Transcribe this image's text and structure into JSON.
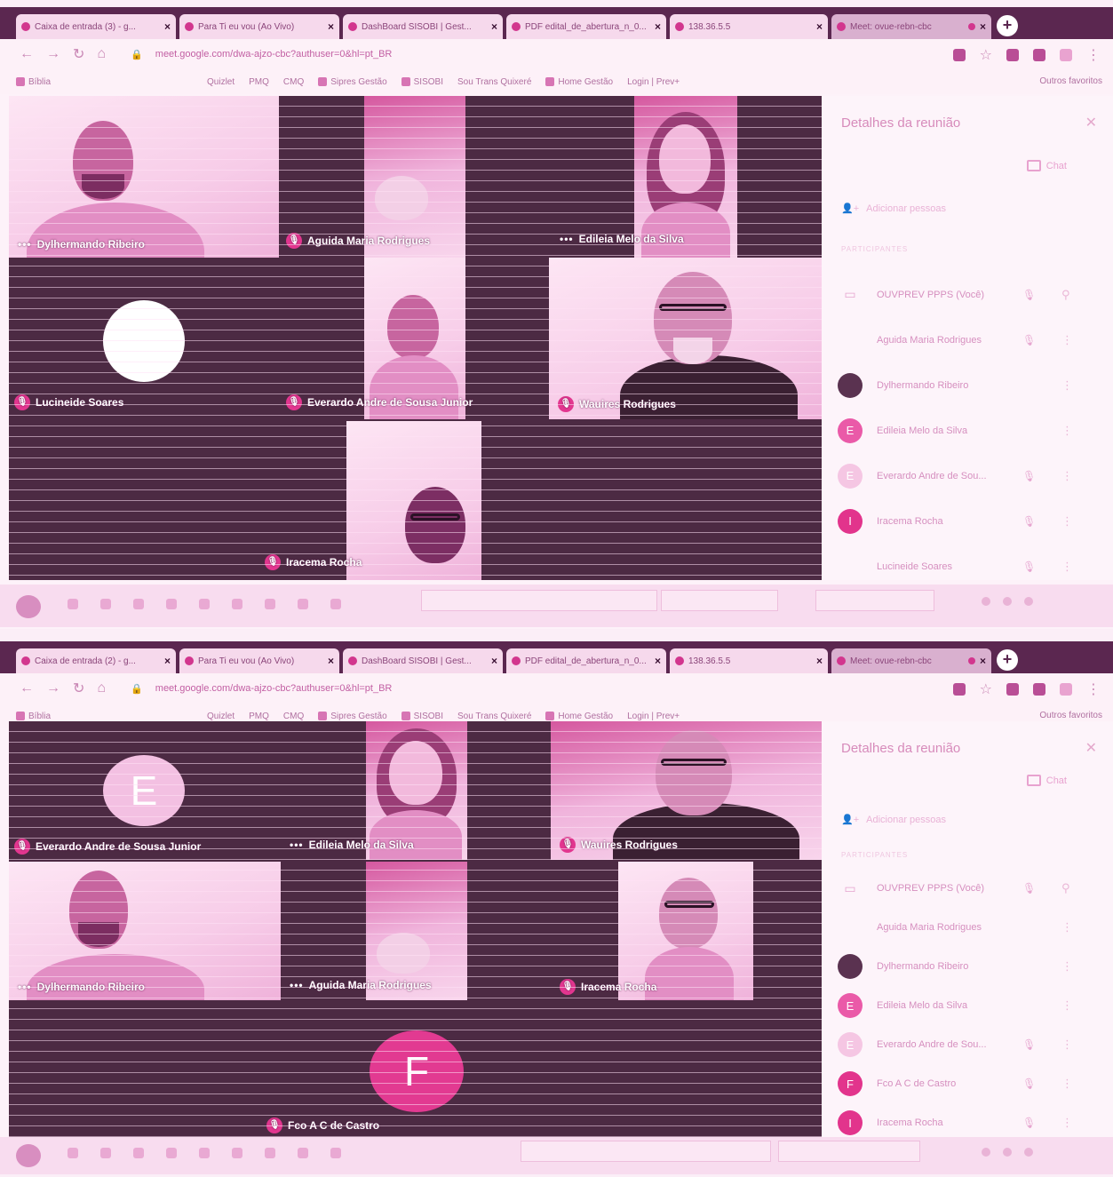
{
  "screens": [
    {
      "tabs": [
        {
          "title": "Caixa de entrada (3) - g...",
          "close": "×"
        },
        {
          "title": "Para Ti eu vou (Ao Vivo)",
          "close": "×"
        },
        {
          "title": "DashBoard SISOBI | Gest...",
          "close": "×"
        },
        {
          "title": "PDF edital_de_abertura_n_0...",
          "close": "×"
        },
        {
          "title": "138.36.5.5",
          "close": "×"
        },
        {
          "title": "Meet: ovue-rebn-cbc",
          "close": "×"
        }
      ],
      "new_tab": "+",
      "url": "meet.google.com/dwa-ajzo-cbc?authuser=0&hl=pt_BR",
      "bookmarks": [
        "Bíblia",
        "Quizlet",
        "PMQ",
        "CMQ",
        "Sipres Gestão",
        "SISOBI",
        "Sou Trans Quixeré",
        "Home Gestão",
        "Login | Prev+"
      ],
      "other_bookmarks": "Outros favoritos",
      "tiles": {
        "dylhermando": "Dylhermando Ribeiro",
        "aguida": "Aguida Maria Rodrigues",
        "edileia": "Edileia Melo da Silva",
        "lucineide": "Lucineide Soares",
        "everardo": "Everardo Andre de Sousa Junior",
        "wauires": "Wauires Rodrigues",
        "iracema": "Iracema Rocha"
      },
      "panel": {
        "title": "Detalhes da reunião",
        "chat": "Chat",
        "add_people": "Adicionar pessoas",
        "section": "PARTICIPANTES",
        "participants": [
          {
            "name": "OUVPREV PPPS (Você)",
            "avatar": ""
          },
          {
            "name": "Aguida Maria Rodrigues",
            "avatar": ""
          },
          {
            "name": "Dylhermando Ribeiro",
            "avatar": ""
          },
          {
            "name": "Edileia Melo da Silva",
            "avatar": "E"
          },
          {
            "name": "Everardo Andre de Sou...",
            "avatar": "E"
          },
          {
            "name": "Iracema Rocha",
            "avatar": "I"
          },
          {
            "name": "Lucineide Soares",
            "avatar": ""
          }
        ]
      }
    },
    {
      "tabs": [
        {
          "title": "Caixa de entrada (2) - g...",
          "close": "×"
        },
        {
          "title": "Para Ti eu vou (Ao Vivo)",
          "close": "×"
        },
        {
          "title": "DashBoard SISOBI | Gest...",
          "close": "×"
        },
        {
          "title": "PDF edital_de_abertura_n_0...",
          "close": "×"
        },
        {
          "title": "138.36.5.5",
          "close": "×"
        },
        {
          "title": "Meet: ovue-rebn-cbc",
          "close": "×"
        }
      ],
      "new_tab": "+",
      "url": "meet.google.com/dwa-ajzo-cbc?authuser=0&hl=pt_BR",
      "bookmarks": [
        "Bíblia",
        "Quizlet",
        "PMQ",
        "CMQ",
        "Sipres Gestão",
        "SISOBI",
        "Sou Trans Quixeré",
        "Home Gestão",
        "Login | Prev+"
      ],
      "other_bookmarks": "Outros favoritos",
      "tiles": {
        "everardo": "Everardo Andre de Sousa Junior",
        "everardo_initial": "E",
        "edileia": "Edileia Melo da Silva",
        "wauires": "Wauires Rodrigues",
        "dylhermando": "Dylhermando Ribeiro",
        "aguida": "Aguida Maria Rodrigues",
        "iracema": "Iracema Rocha",
        "fco": "Fco A C de Castro",
        "fco_initial": "F"
      },
      "panel": {
        "title": "Detalhes da reunião",
        "chat": "Chat",
        "add_people": "Adicionar pessoas",
        "section": "PARTICIPANTES",
        "participants": [
          {
            "name": "OUVPREV PPPS (Você)",
            "avatar": ""
          },
          {
            "name": "Aguida Maria Rodrigues",
            "avatar": ""
          },
          {
            "name": "Dylhermando Ribeiro",
            "avatar": ""
          },
          {
            "name": "Edileia Melo da Silva",
            "avatar": "E"
          },
          {
            "name": "Everardo Andre de Sou...",
            "avatar": "E"
          },
          {
            "name": "Fco A C de Castro",
            "avatar": "F"
          },
          {
            "name": "Iracema Rocha",
            "avatar": "I"
          }
        ]
      }
    }
  ],
  "colors": {
    "accent": "#e2368f",
    "stage": "#4c2a43",
    "tint": "#f4b6df"
  },
  "icons": [
    "mic-off-icon",
    "more-dots-icon",
    "close-icon",
    "chat-icon",
    "add-person-icon",
    "pin-icon",
    "kebab-menu-icon",
    "lock-icon",
    "star-icon"
  ]
}
